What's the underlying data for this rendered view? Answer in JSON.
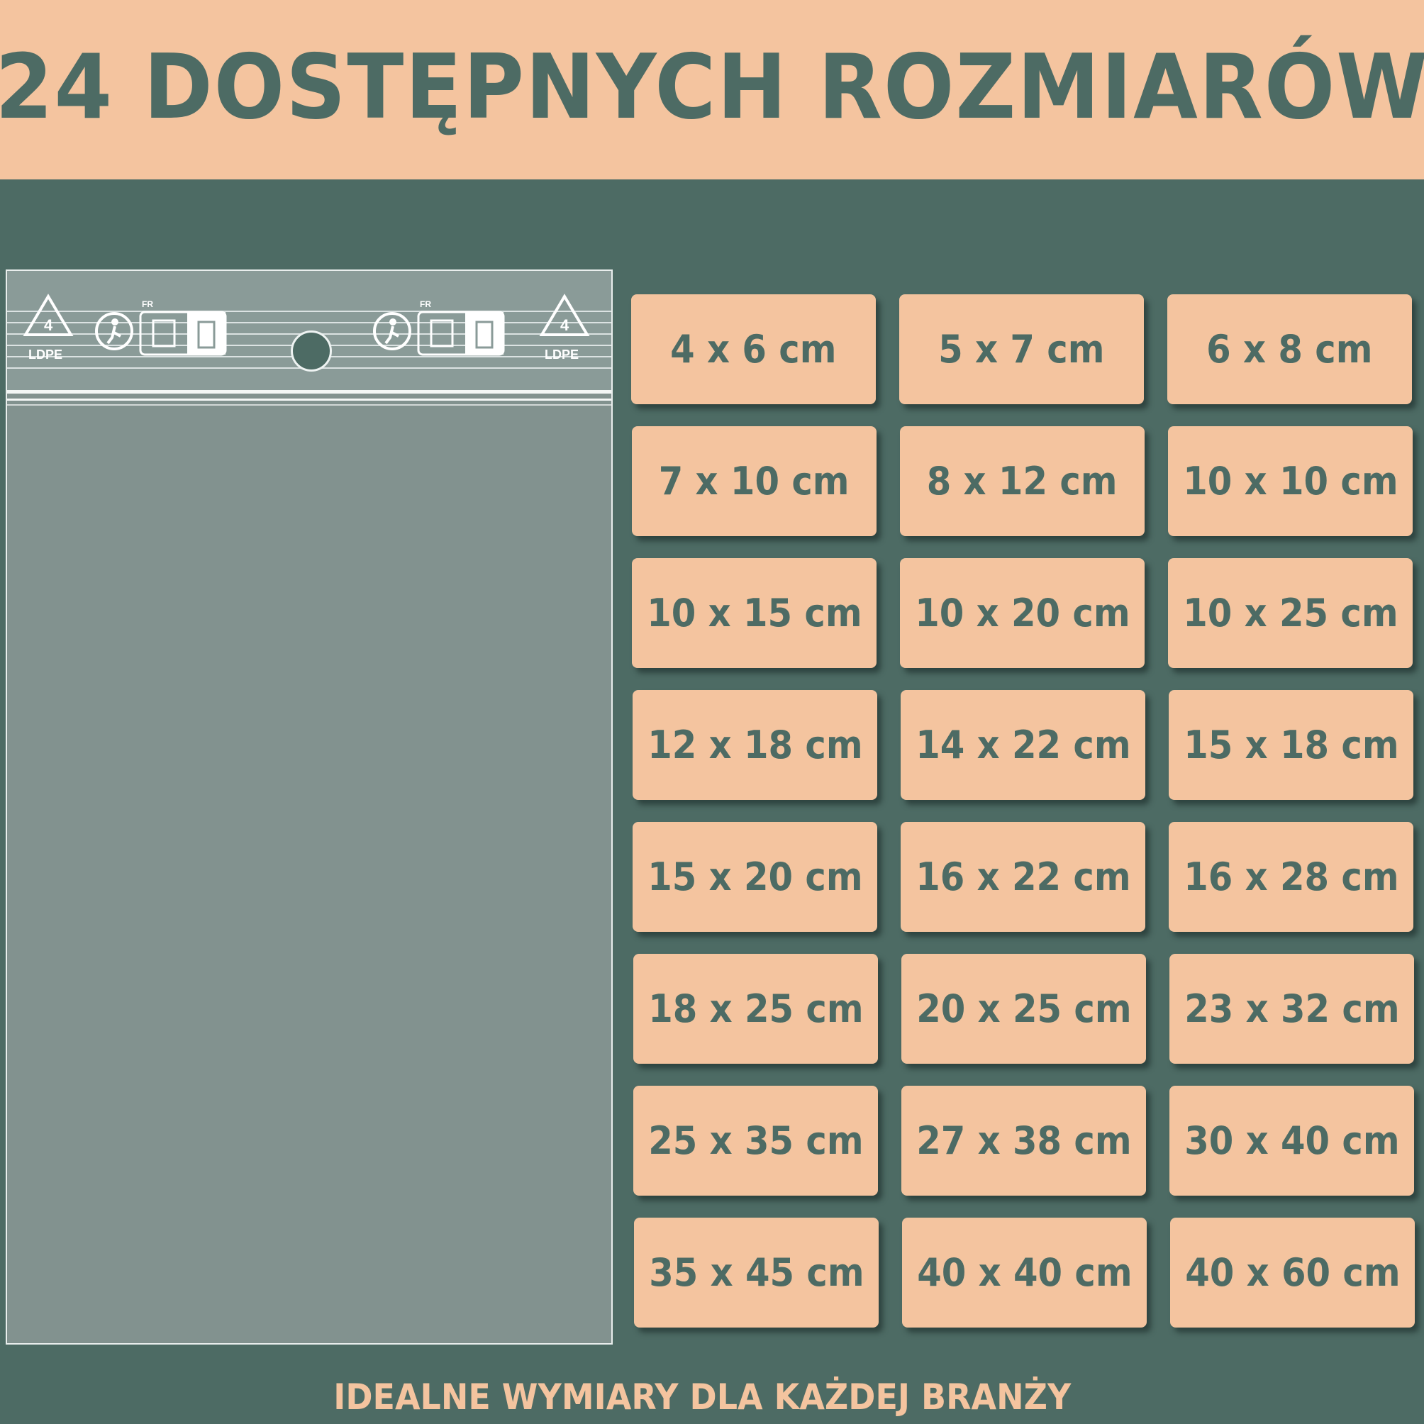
{
  "header": {
    "title": "24 DOSTĘPNYCH ROZMIARÓW"
  },
  "bag": {
    "ldpe_left": "LDPE",
    "ldpe_right": "LDPE",
    "recycle_code_left": "4",
    "recycle_code_right": "4",
    "fr_left": "FR",
    "fr_right": "FR"
  },
  "sizes": [
    "4 x 6 cm",
    "5 x 7 cm",
    "6 x 8 cm",
    "7 x 10 cm",
    "8 x 12 cm",
    "10 x 10 cm",
    "10 x 15 cm",
    "10 x 20 cm",
    "10 x 25 cm",
    "12 x 18 cm",
    "14 x 22 cm",
    "15 x 18 cm",
    "15 x 20 cm",
    "16 x 22 cm",
    "16 x 28 cm",
    "18 x 25 cm",
    "20 x 25 cm",
    "23 x 32 cm",
    "25 x 35 cm",
    "27 x 38 cm",
    "30 x 40 cm",
    "35 x 45 cm",
    "40 x 40 cm",
    "40 x 60 cm"
  ],
  "footer": {
    "text": "IDEALNE WYMIARY DLA KAŻDEJ BRANŻY"
  },
  "colors": {
    "peach": "#f4c49f",
    "teal": "#4d6b64",
    "bag": "#82928f"
  }
}
